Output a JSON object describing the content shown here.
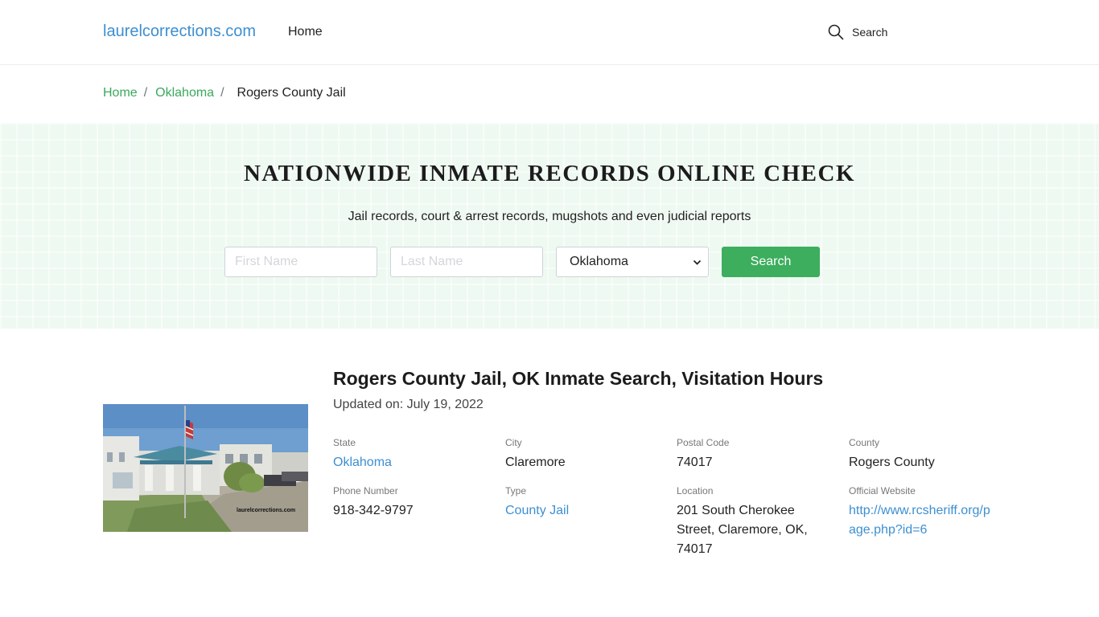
{
  "header": {
    "logo": "laurelcorrections.com",
    "nav_home": "Home",
    "search_label": "Search"
  },
  "breadcrumb": {
    "home": "Home",
    "state": "Oklahoma",
    "current": "Rogers County Jail"
  },
  "hero": {
    "title": "NATIONWIDE INMATE RECORDS ONLINE CHECK",
    "subtitle": "Jail records, court & arrest records, mugshots and even judicial reports",
    "first_name_placeholder": "First Name",
    "last_name_placeholder": "Last Name",
    "state_selected": "Oklahoma",
    "search_button": "Search"
  },
  "facility": {
    "image_watermark": "laurelcorrections.com",
    "title": "Rogers County Jail, OK Inmate Search, Visitation Hours",
    "updated": "Updated on: July 19, 2022",
    "state_label": "State",
    "state": "Oklahoma",
    "city_label": "City",
    "city": "Claremore",
    "postal_label": "Postal Code",
    "postal": "74017",
    "county_label": "County",
    "county": "Rogers County",
    "phone_label": "Phone Number",
    "phone": "918-342-9797",
    "type_label": "Type",
    "type": "County Jail",
    "location_label": "Location",
    "location_line1": "201 South Cherokee",
    "location_line2": "Street, Claremore, OK,",
    "location_line3": "74017",
    "website_label": "Official Website",
    "website_line1": "http://www.rcsheriff.org/p",
    "website_line2": "age.php?id=6"
  },
  "colors": {
    "link_blue": "#3d8fd1",
    "breadcrumb_green": "#3aa95c",
    "button_green": "#3cae5e",
    "hero_bg": "#eef9f1"
  }
}
